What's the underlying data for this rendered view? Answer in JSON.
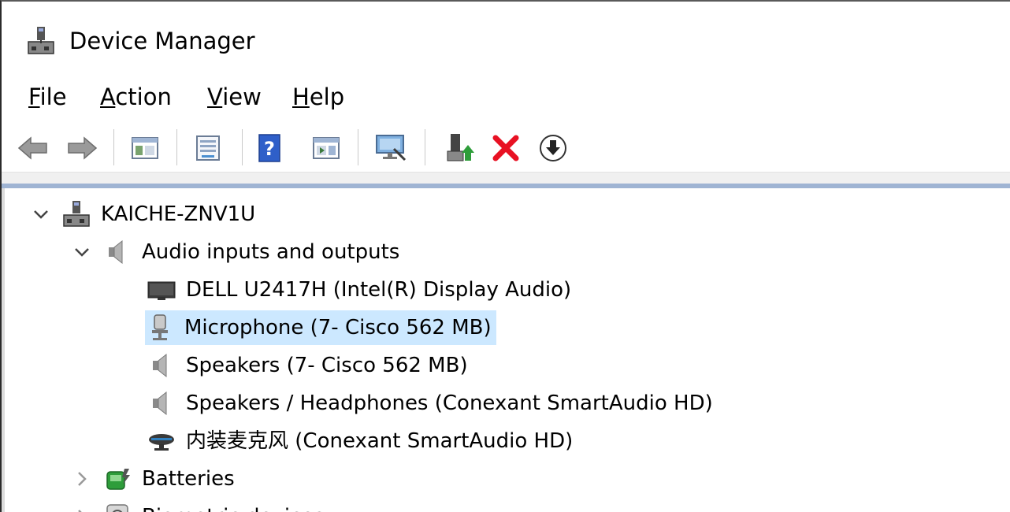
{
  "window": {
    "title": "Device Manager"
  },
  "menu": {
    "file": {
      "accel": "F",
      "rest": "ile"
    },
    "action": {
      "accel": "A",
      "rest": "ction"
    },
    "view": {
      "accel": "V",
      "rest": "iew"
    },
    "help": {
      "accel": "H",
      "rest": "elp"
    }
  },
  "toolbar": {
    "icons": [
      "back-arrow-icon",
      "forward-arrow-icon",
      "show-hide-console-tree-icon",
      "properties-icon",
      "help-icon",
      "show-action-pane-icon",
      "scan-hardware-icon",
      "update-driver-icon",
      "uninstall-device-icon",
      "download-driver-icon"
    ],
    "colors": {
      "uninstall": "#e81123",
      "help": "#2f5fc9",
      "update": "#2e9d3a"
    }
  },
  "tree": {
    "root": {
      "label": "KAICHE-ZNV1U",
      "expanded": true
    },
    "categories": [
      {
        "label": "Audio inputs and outputs",
        "expanded": true,
        "devices": [
          {
            "label": "DELL U2417H (Intel(R) Display Audio)",
            "icon": "monitor-icon"
          },
          {
            "label": "Microphone (7- Cisco 562 MB)",
            "icon": "microphone-icon",
            "selected": true
          },
          {
            "label": "Speakers (7- Cisco 562 MB)",
            "icon": "speaker-icon"
          },
          {
            "label": "Speakers / Headphones (Conexant SmartAudio HD)",
            "icon": "speaker-icon"
          },
          {
            "label": "内装麦克风 (Conexant SmartAudio HD)",
            "icon": "webcam-mic-icon"
          }
        ]
      },
      {
        "label": "Batteries",
        "expanded": false
      },
      {
        "label": "Biometric devices",
        "expanded": false
      }
    ]
  }
}
